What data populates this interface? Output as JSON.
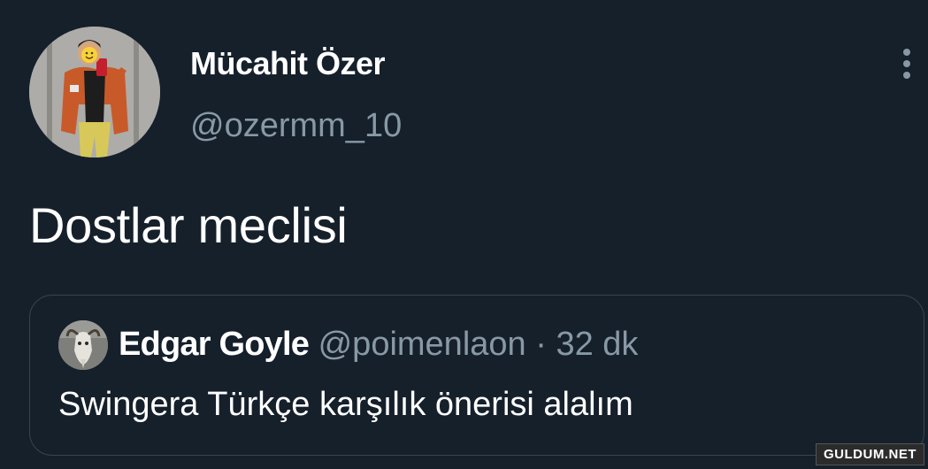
{
  "tweet": {
    "author": {
      "display_name": "Mücahit Özer",
      "handle": "@ozermm_10"
    },
    "text": "Dostlar meclisi",
    "more_icon": "more-vertical-icon"
  },
  "quoted_tweet": {
    "author": {
      "display_name": "Edgar Goyle",
      "handle": "@poimenlaon"
    },
    "separator": "·",
    "time": "32 dk",
    "text": "Swingera Türkçe karşılık önerisi alalım"
  },
  "watermark": "GULDUM.NET",
  "colors": {
    "background": "#15202b",
    "text_primary": "#ffffff",
    "text_secondary": "#8899a6",
    "border": "#38444d"
  }
}
